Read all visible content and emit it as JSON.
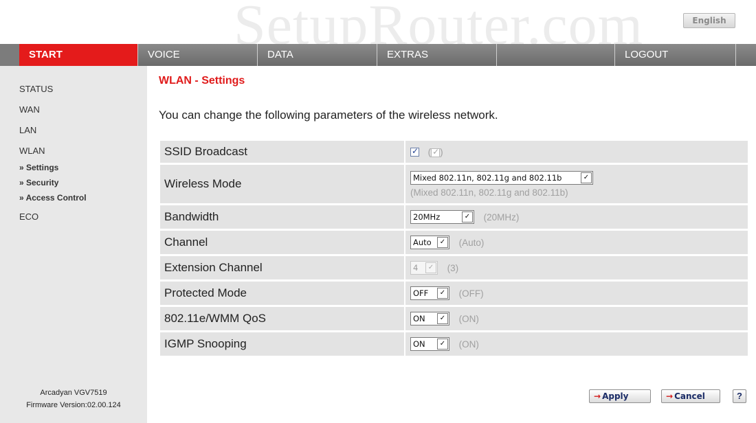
{
  "watermark": "SetupRouter.com",
  "language_button": "English",
  "nav": {
    "items": [
      {
        "label": "START",
        "active": true
      },
      {
        "label": "VOICE",
        "active": false
      },
      {
        "label": "DATA",
        "active": false
      },
      {
        "label": "EXTRAS",
        "active": false
      },
      {
        "label": "",
        "active": false
      },
      {
        "label": "LOGOUT",
        "active": false
      },
      {
        "label": "",
        "active": false
      }
    ]
  },
  "sidebar": {
    "links": [
      "STATUS",
      "WAN",
      "LAN",
      "WLAN"
    ],
    "sublinks": [
      "» Settings",
      "» Security",
      "» Access Control"
    ],
    "eco": "ECO",
    "device_model": "Arcadyan VGV7519",
    "firmware": "Firmware Version:02.00.124"
  },
  "main": {
    "title": "WLAN - Settings",
    "intro": "You can change the following parameters of the wireless network.",
    "rows": {
      "ssid": {
        "label": "SSID Broadcast",
        "checked": true,
        "current_open": "(",
        "current_close": ")"
      },
      "mode": {
        "label": "Wireless Mode",
        "value": "Mixed 802.11n, 802.11g and 802.11b",
        "current": "(Mixed 802.11n, 802.11g and 802.11b)"
      },
      "bandwidth": {
        "label": "Bandwidth",
        "value": "20MHz",
        "current": "(20MHz)"
      },
      "channel": {
        "label": "Channel",
        "value": "Auto",
        "current": "(Auto)"
      },
      "extension": {
        "label": "Extension Channel",
        "value": "4",
        "current": "(3)"
      },
      "protected": {
        "label": "Protected Mode",
        "value": "OFF",
        "current": "(OFF)"
      },
      "wmm": {
        "label": "802.11e/WMM QoS",
        "value": "ON",
        "current": "(ON)"
      },
      "igmp": {
        "label": "IGMP Snooping",
        "value": "ON",
        "current": "(ON)"
      }
    }
  },
  "buttons": {
    "arrow": "→",
    "apply": "Apply",
    "cancel": "Cancel",
    "help": "?"
  }
}
